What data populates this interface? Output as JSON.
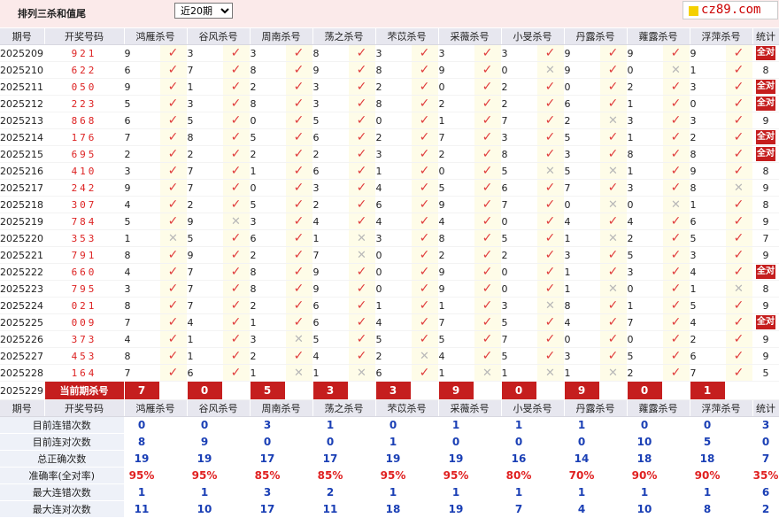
{
  "title": "排列三杀和值尾",
  "period_select": "近20期",
  "logo": "cz89.com",
  "headers": [
    "期号",
    "开奖号码",
    "鸿雁杀号",
    "谷风杀号",
    "周南杀号",
    "荡之杀号",
    "芣苡杀号",
    "采薇杀号",
    "小旻杀号",
    "丹露杀号",
    "蕹露杀号",
    "浮萍杀号",
    "统计"
  ],
  "rows": [
    {
      "p": "2025209",
      "n": "921",
      "v": [
        "9",
        "3",
        "3",
        "8",
        "3",
        "3",
        "3",
        "9",
        "9",
        "9"
      ],
      "r": [
        1,
        1,
        1,
        1,
        1,
        1,
        1,
        1,
        1,
        1
      ],
      "s": "全对"
    },
    {
      "p": "2025210",
      "n": "622",
      "v": [
        "6",
        "7",
        "8",
        "9",
        "8",
        "9",
        "0",
        "9",
        "0",
        "1"
      ],
      "r": [
        1,
        1,
        1,
        1,
        1,
        1,
        0,
        1,
        0,
        1
      ],
      "s": "8"
    },
    {
      "p": "2025211",
      "n": "050",
      "v": [
        "9",
        "1",
        "2",
        "3",
        "2",
        "0",
        "2",
        "0",
        "2",
        "3"
      ],
      "r": [
        1,
        1,
        1,
        1,
        1,
        1,
        1,
        1,
        1,
        1
      ],
      "s": "全对"
    },
    {
      "p": "2025212",
      "n": "223",
      "v": [
        "5",
        "3",
        "8",
        "3",
        "8",
        "2",
        "2",
        "6",
        "1",
        "0"
      ],
      "r": [
        1,
        1,
        1,
        1,
        1,
        1,
        1,
        1,
        1,
        1
      ],
      "s": "全对"
    },
    {
      "p": "2025213",
      "n": "868",
      "v": [
        "6",
        "5",
        "0",
        "5",
        "0",
        "1",
        "7",
        "2",
        "3",
        "3"
      ],
      "r": [
        1,
        1,
        1,
        1,
        1,
        1,
        1,
        0,
        1,
        1
      ],
      "s": "9"
    },
    {
      "p": "2025214",
      "n": "176",
      "v": [
        "7",
        "8",
        "5",
        "6",
        "2",
        "7",
        "3",
        "5",
        "1",
        "2"
      ],
      "r": [
        1,
        1,
        1,
        1,
        1,
        1,
        1,
        1,
        1,
        1
      ],
      "s": "全对"
    },
    {
      "p": "2025215",
      "n": "695",
      "v": [
        "2",
        "2",
        "2",
        "2",
        "3",
        "2",
        "8",
        "3",
        "8",
        "8"
      ],
      "r": [
        1,
        1,
        1,
        1,
        1,
        1,
        1,
        1,
        1,
        1
      ],
      "s": "全对"
    },
    {
      "p": "2025216",
      "n": "410",
      "v": [
        "3",
        "7",
        "1",
        "6",
        "1",
        "0",
        "5",
        "5",
        "1",
        "9"
      ],
      "r": [
        1,
        1,
        1,
        1,
        1,
        1,
        0,
        0,
        1,
        1
      ],
      "s": "8"
    },
    {
      "p": "2025217",
      "n": "242",
      "v": [
        "9",
        "7",
        "0",
        "3",
        "4",
        "5",
        "6",
        "7",
        "3",
        "8"
      ],
      "r": [
        1,
        1,
        1,
        1,
        1,
        1,
        1,
        1,
        1,
        0
      ],
      "s": "9"
    },
    {
      "p": "2025218",
      "n": "307",
      "v": [
        "4",
        "2",
        "5",
        "2",
        "6",
        "9",
        "7",
        "0",
        "0",
        "1"
      ],
      "r": [
        1,
        1,
        1,
        1,
        1,
        1,
        1,
        0,
        0,
        1
      ],
      "s": "8"
    },
    {
      "p": "2025219",
      "n": "784",
      "v": [
        "5",
        "9",
        "3",
        "4",
        "4",
        "4",
        "0",
        "4",
        "4",
        "6"
      ],
      "r": [
        1,
        0,
        1,
        1,
        1,
        1,
        1,
        1,
        1,
        1
      ],
      "s": "9"
    },
    {
      "p": "2025220",
      "n": "353",
      "v": [
        "1",
        "5",
        "6",
        "1",
        "3",
        "8",
        "5",
        "1",
        "2",
        "5"
      ],
      "r": [
        0,
        1,
        1,
        0,
        1,
        1,
        1,
        0,
        1,
        1
      ],
      "s": "7"
    },
    {
      "p": "2025221",
      "n": "791",
      "v": [
        "8",
        "9",
        "2",
        "7",
        "0",
        "2",
        "2",
        "3",
        "5",
        "3"
      ],
      "r": [
        1,
        1,
        1,
        0,
        1,
        1,
        1,
        1,
        1,
        1
      ],
      "s": "9"
    },
    {
      "p": "2025222",
      "n": "660",
      "v": [
        "4",
        "7",
        "8",
        "9",
        "0",
        "9",
        "0",
        "1",
        "3",
        "4"
      ],
      "r": [
        1,
        1,
        1,
        1,
        1,
        1,
        1,
        1,
        1,
        1
      ],
      "s": "全对"
    },
    {
      "p": "2025223",
      "n": "795",
      "v": [
        "3",
        "7",
        "8",
        "9",
        "0",
        "9",
        "0",
        "1",
        "0",
        "1"
      ],
      "r": [
        1,
        1,
        1,
        1,
        1,
        1,
        1,
        0,
        1,
        0
      ],
      "s": "8"
    },
    {
      "p": "2025224",
      "n": "021",
      "v": [
        "8",
        "7",
        "2",
        "6",
        "1",
        "1",
        "3",
        "8",
        "1",
        "5"
      ],
      "r": [
        1,
        1,
        1,
        1,
        1,
        1,
        0,
        1,
        1,
        1
      ],
      "s": "9"
    },
    {
      "p": "2025225",
      "n": "009",
      "v": [
        "7",
        "4",
        "1",
        "6",
        "4",
        "7",
        "5",
        "4",
        "7",
        "4"
      ],
      "r": [
        1,
        1,
        1,
        1,
        1,
        1,
        1,
        1,
        1,
        1
      ],
      "s": "全对"
    },
    {
      "p": "2025226",
      "n": "373",
      "v": [
        "4",
        "1",
        "3",
        "5",
        "5",
        "5",
        "7",
        "0",
        "0",
        "2"
      ],
      "r": [
        1,
        1,
        0,
        1,
        1,
        1,
        1,
        1,
        1,
        1
      ],
      "s": "9"
    },
    {
      "p": "2025227",
      "n": "453",
      "v": [
        "8",
        "1",
        "2",
        "4",
        "2",
        "4",
        "5",
        "3",
        "5",
        "6"
      ],
      "r": [
        1,
        1,
        1,
        1,
        0,
        1,
        1,
        1,
        1,
        1
      ],
      "s": "9"
    },
    {
      "p": "2025228",
      "n": "164",
      "v": [
        "7",
        "6",
        "1",
        "1",
        "6",
        "1",
        "1",
        "1",
        "2",
        "7"
      ],
      "r": [
        1,
        1,
        0,
        0,
        1,
        0,
        0,
        0,
        1,
        1
      ],
      "s": "5"
    }
  ],
  "current": {
    "p": "2025229",
    "label": "当前期杀号",
    "v": [
      "7",
      "0",
      "5",
      "3",
      "3",
      "9",
      "0",
      "9",
      "0",
      "1"
    ]
  },
  "stats": [
    {
      "label": "目前连错次数",
      "v": [
        "0",
        "0",
        "3",
        "1",
        "0",
        "1",
        "1",
        "1",
        "0",
        "0",
        "3"
      ],
      "red": false
    },
    {
      "label": "目前连对次数",
      "v": [
        "8",
        "9",
        "0",
        "0",
        "1",
        "0",
        "0",
        "0",
        "10",
        "5",
        "0"
      ],
      "red": false
    },
    {
      "label": "总正确次数",
      "v": [
        "19",
        "19",
        "17",
        "17",
        "19",
        "19",
        "16",
        "14",
        "18",
        "18",
        "7"
      ],
      "red": false
    },
    {
      "label": "准确率(全对率)",
      "v": [
        "95%",
        "95%",
        "85%",
        "85%",
        "95%",
        "95%",
        "80%",
        "70%",
        "90%",
        "90%",
        "35%"
      ],
      "red": true
    },
    {
      "label": "最大连错次数",
      "v": [
        "1",
        "1",
        "3",
        "2",
        "1",
        "1",
        "1",
        "1",
        "1",
        "1",
        "6"
      ],
      "red": false
    },
    {
      "label": "最大连对次数",
      "v": [
        "11",
        "10",
        "17",
        "11",
        "18",
        "19",
        "7",
        "4",
        "10",
        "8",
        "2"
      ],
      "red": false
    }
  ]
}
